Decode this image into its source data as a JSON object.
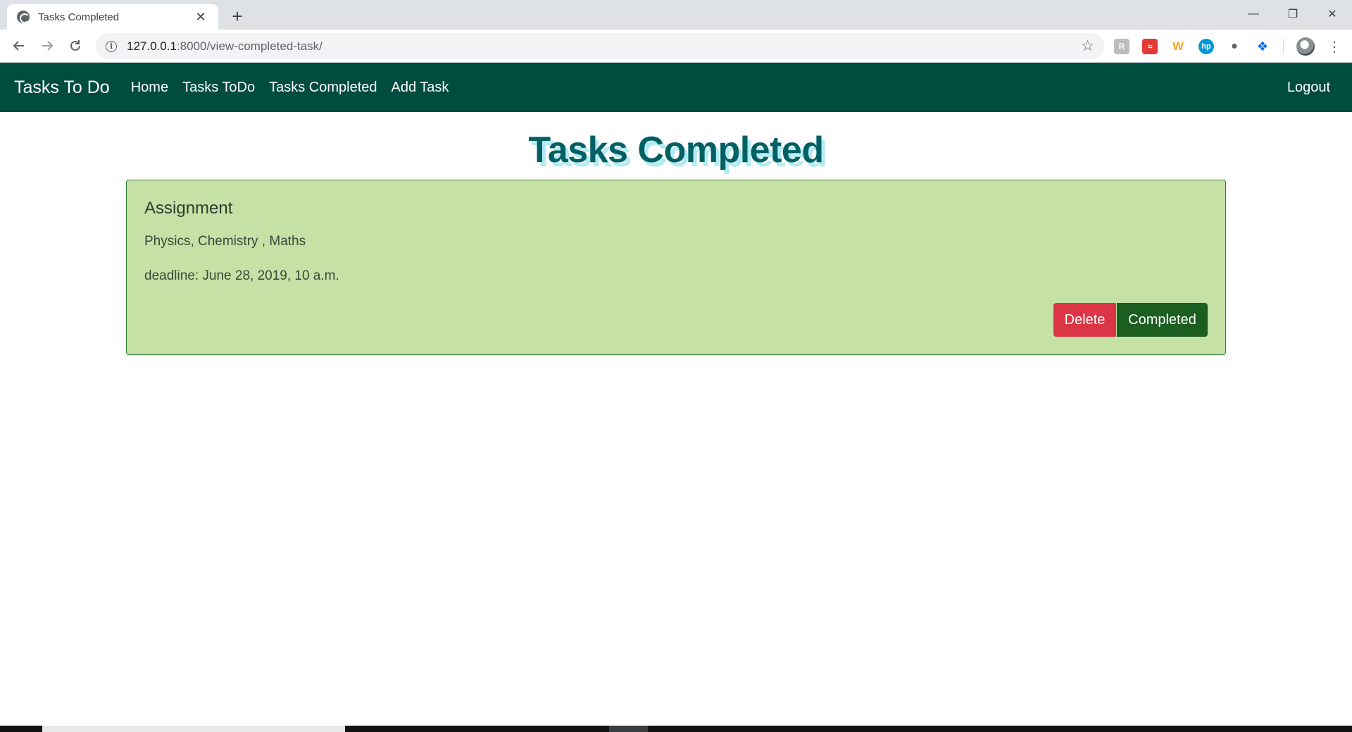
{
  "browser": {
    "tab_title": "Tasks Completed",
    "tab_close": "✕",
    "new_tab": "+",
    "url_host": "127.0.0.1",
    "url_rest": ":8000/view-completed-task/",
    "window": {
      "minimize": "—",
      "restore": "❐",
      "close": "✕"
    },
    "icons": {
      "back": "back-arrow-icon",
      "forward": "forward-arrow-icon",
      "reload": "reload-icon",
      "info": "info-icon",
      "star": "bookmark-star-icon",
      "menu": "menu-dots-icon"
    },
    "extensions": [
      {
        "name": "ext-bookmark-icon",
        "glyph": "R",
        "color": "#9e9e9e"
      },
      {
        "name": "ext-pdf-icon",
        "glyph": "≈",
        "color": "#e53935"
      },
      {
        "name": "ext-w-icon",
        "glyph": "W",
        "color": "#f5a623"
      },
      {
        "name": "ext-hp-icon",
        "glyph": "hp",
        "color": "#0096d6"
      },
      {
        "name": "ext-circle-icon",
        "glyph": "●",
        "color": "#5f6368"
      },
      {
        "name": "ext-dropbox-icon",
        "glyph": "❖",
        "color": "#0061fe"
      }
    ]
  },
  "navbar": {
    "brand": "Tasks To Do",
    "links": [
      "Home",
      "Tasks ToDo",
      "Tasks Completed",
      "Add Task"
    ],
    "logout": "Logout",
    "bg_color": "#004d40"
  },
  "main": {
    "title": "Tasks Completed",
    "tasks": [
      {
        "title": "Assignment",
        "description": "Physics, Chemistry , Maths",
        "deadline": "deadline: June 28, 2019, 10 a.m.",
        "delete_label": "Delete",
        "completed_label": "Completed"
      }
    ]
  },
  "colors": {
    "card_bg": "#c5e1a5",
    "delete": "#dc3545",
    "completed": "#1b5e20",
    "title": "#006064"
  }
}
